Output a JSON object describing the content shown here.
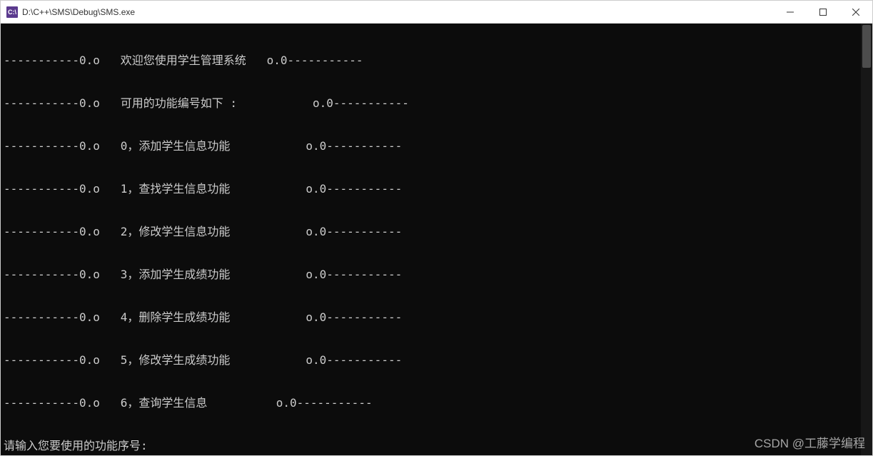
{
  "window": {
    "title": "D:\\C++\\SMS\\Debug\\SMS.exe",
    "icon_label": "C:\\"
  },
  "console": {
    "lines": [
      "-----------0.o   欢迎您使用学生管理系统   o.0-----------",
      "-----------0.o   可用的功能编号如下 :           o.0-----------",
      "-----------0.o   0，添加学生信息功能           o.0-----------",
      "-----------0.o   1，查找学生信息功能           o.0-----------",
      "-----------0.o   2，修改学生信息功能           o.0-----------",
      "-----------0.o   3，添加学生成绩功能           o.0-----------",
      "-----------0.o   4，删除学生成绩功能           o.0-----------",
      "-----------0.o   5，修改学生成绩功能           o.0-----------",
      "-----------0.o   6，查询学生信息          o.0-----------",
      "请输入您要使用的功能序号:"
    ]
  },
  "watermark": "CSDN @工藤学编程"
}
